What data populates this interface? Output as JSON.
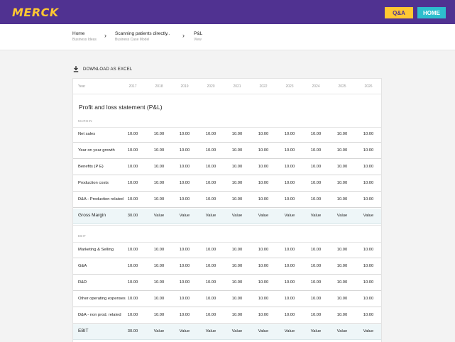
{
  "header": {
    "logo": "MERCK",
    "qa_label": "Q&A",
    "home_label": "HOME"
  },
  "breadcrumb": [
    {
      "title": "Home",
      "subtitle": "Business Ideas"
    },
    {
      "title": "Scanning patients directly..",
      "subtitle": "Business Case Model"
    },
    {
      "title": "P&L",
      "subtitle": "View"
    }
  ],
  "download_label": "DOWNLOAD AS EXCEL",
  "table": {
    "year_label": "Year",
    "years": [
      "2017",
      "2018",
      "2019",
      "2020",
      "2021",
      "2022",
      "2023",
      "2024",
      "2025",
      "2026"
    ],
    "title": "Profit and loss statement (P&L)",
    "margin_section": {
      "label": "MARGIN",
      "rows": [
        {
          "label": "Net sales",
          "values": [
            "10.00",
            "10.00",
            "10.00",
            "10.00",
            "10.00",
            "10.00",
            "10.00",
            "10.00",
            "10.00",
            "10.00"
          ]
        },
        {
          "label": "Year on year growth",
          "values": [
            "10.00",
            "10.00",
            "10.00",
            "10.00",
            "10.00",
            "10.00",
            "10.00",
            "10.00",
            "10.00",
            "10.00"
          ]
        },
        {
          "label": "Benefits (P E)",
          "values": [
            "10.00",
            "10.00",
            "10.00",
            "10.00",
            "10.00",
            "10.00",
            "10.00",
            "10.00",
            "10.00",
            "10.00"
          ]
        },
        {
          "label": "Production costs",
          "values": [
            "10.00",
            "10.00",
            "10.00",
            "10.00",
            "10.00",
            "10.00",
            "10.00",
            "10.00",
            "10.00",
            "10.00"
          ]
        },
        {
          "label": "D&A - Production related",
          "values": [
            "10.00",
            "10.00",
            "10.00",
            "10.00",
            "10.00",
            "10.00",
            "10.00",
            "10.00",
            "10.00",
            "10.00"
          ]
        }
      ],
      "total": {
        "label": "Gross Margin",
        "values": [
          "30.00",
          "Value",
          "Value",
          "Value",
          "Value",
          "Value",
          "Value",
          "Value",
          "Value",
          "Value"
        ]
      }
    },
    "ebit_section": {
      "label": "EBIT",
      "rows": [
        {
          "label": "Marketing & Selling",
          "values": [
            "10.00",
            "10.00",
            "10.00",
            "10.00",
            "10.00",
            "10.00",
            "10.00",
            "10.00",
            "10.00",
            "10.00"
          ]
        },
        {
          "label": "G&A",
          "values": [
            "10.00",
            "10.00",
            "10.00",
            "10.00",
            "10.00",
            "10.00",
            "10.00",
            "10.00",
            "10.00",
            "10.00"
          ]
        },
        {
          "label": "R&D",
          "values": [
            "10.00",
            "10.00",
            "10.00",
            "10.00",
            "10.00",
            "10.00",
            "10.00",
            "10.00",
            "10.00",
            "10.00"
          ]
        },
        {
          "label": "Other operating expenses",
          "values": [
            "10.00",
            "10.00",
            "10.00",
            "10.00",
            "10.00",
            "10.00",
            "10.00",
            "10.00",
            "10.00",
            "10.00"
          ]
        },
        {
          "label": "D&A - non prod. related",
          "values": [
            "10.00",
            "10.00",
            "10.00",
            "10.00",
            "10.00",
            "10.00",
            "10.00",
            "10.00",
            "10.00",
            "10.00"
          ]
        }
      ],
      "total": {
        "label": "EBIT",
        "values": [
          "30.00",
          "Value",
          "Value",
          "Value",
          "Value",
          "Value",
          "Value",
          "Value",
          "Value",
          "Value"
        ]
      }
    }
  },
  "colors": {
    "brand_purple": "#503291",
    "brand_yellow": "#ffc832",
    "brand_cyan": "#2dbecd",
    "total_row_bg": "#eef6f8"
  }
}
